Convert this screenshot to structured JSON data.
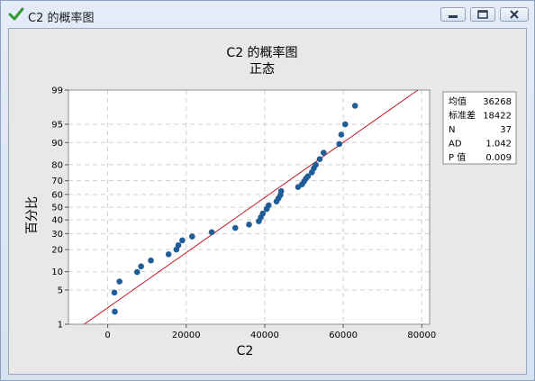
{
  "window": {
    "title": "C2 的概率图",
    "icon": "check-icon",
    "controls": [
      "minimize-icon",
      "restore-icon",
      "close-icon"
    ]
  },
  "chart_data": {
    "type": "scatter",
    "title": "C2 的概率图",
    "subtitle": "正态",
    "xlabel": "C2",
    "ylabel": "百分比",
    "scale": "normal-probability",
    "xlim": [
      -10000,
      82000
    ],
    "ylim": [
      1,
      99
    ],
    "x_ticks": [
      0,
      20000,
      40000,
      60000,
      80000
    ],
    "x_tick_labels": [
      "0",
      "20000",
      "40000",
      "60000",
      "80000"
    ],
    "y_ticks": [
      1,
      5,
      10,
      20,
      30,
      40,
      50,
      60,
      70,
      80,
      90,
      95,
      99
    ],
    "y_tick_labels": [
      "1",
      "5",
      "10",
      "20",
      "30",
      "40",
      "50",
      "60",
      "70",
      "80",
      "90",
      "95",
      "99"
    ],
    "grid": true,
    "legend_position": "right",
    "fit_line": {
      "color": "#c0141e",
      "x_at_p1": -6000,
      "x_at_p99": 79000
    },
    "series": [
      {
        "marker_color": "#1f5d99",
        "points": [
          {
            "x": 1800,
            "y": 1.9
          },
          {
            "x": 1700,
            "y": 4.5
          },
          {
            "x": 3000,
            "y": 7.0
          },
          {
            "x": 7500,
            "y": 9.9
          },
          {
            "x": 8500,
            "y": 12.0
          },
          {
            "x": 11000,
            "y": 14.5
          },
          {
            "x": 15500,
            "y": 17.5
          },
          {
            "x": 17500,
            "y": 20.0
          },
          {
            "x": 18000,
            "y": 22.5
          },
          {
            "x": 19000,
            "y": 25.5
          },
          {
            "x": 21500,
            "y": 28.0
          },
          {
            "x": 26500,
            "y": 31.0
          },
          {
            "x": 32500,
            "y": 34.0
          },
          {
            "x": 36000,
            "y": 36.5
          },
          {
            "x": 38500,
            "y": 39.0
          },
          {
            "x": 39000,
            "y": 42.0
          },
          {
            "x": 39500,
            "y": 45.0
          },
          {
            "x": 40500,
            "y": 48.5
          },
          {
            "x": 41000,
            "y": 51.5
          },
          {
            "x": 43000,
            "y": 54.5
          },
          {
            "x": 43500,
            "y": 57.0
          },
          {
            "x": 44000,
            "y": 59.5
          },
          {
            "x": 44200,
            "y": 62.5
          },
          {
            "x": 48500,
            "y": 65.5
          },
          {
            "x": 49500,
            "y": 67.5
          },
          {
            "x": 50000,
            "y": 69.5
          },
          {
            "x": 50500,
            "y": 71.5
          },
          {
            "x": 51000,
            "y": 73.0
          },
          {
            "x": 52000,
            "y": 75.5
          },
          {
            "x": 52500,
            "y": 78.0
          },
          {
            "x": 53000,
            "y": 80.0
          },
          {
            "x": 54000,
            "y": 83.0
          },
          {
            "x": 55000,
            "y": 86.0
          },
          {
            "x": 59000,
            "y": 89.5
          },
          {
            "x": 59500,
            "y": 92.5
          },
          {
            "x": 60500,
            "y": 95.0
          },
          {
            "x": 63000,
            "y": 97.8
          }
        ]
      }
    ],
    "legend": [
      {
        "label": "均值",
        "value": "36268"
      },
      {
        "label": "标准差",
        "value": "18422"
      },
      {
        "label": "N",
        "value": "37"
      },
      {
        "label": "AD",
        "value": "1.042"
      },
      {
        "label": "P 值",
        "value": "0.009"
      }
    ]
  }
}
